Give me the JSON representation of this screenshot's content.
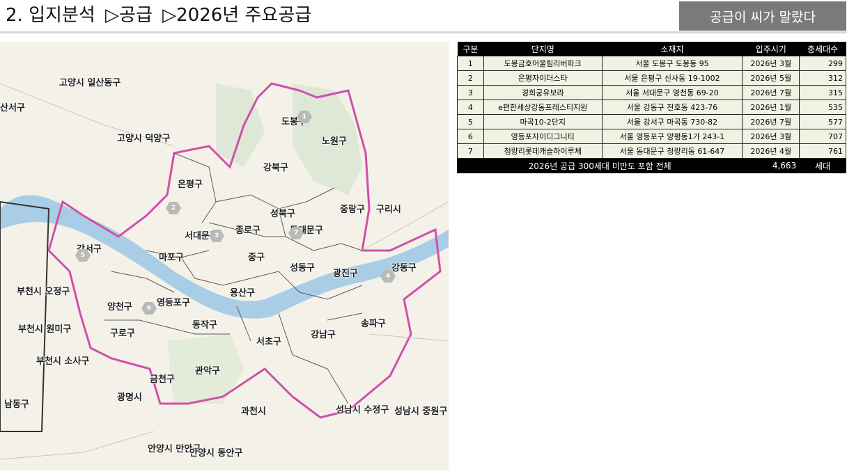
{
  "header": {
    "title_parts": [
      "2. 입지분석",
      "▷공급",
      "▷2026년 주요공급"
    ],
    "badge": "공급이 씨가 말랐다"
  },
  "map": {
    "labels": [
      {
        "text": "고양시 일산동구"
      },
      {
        "text": "산서구"
      },
      {
        "text": "고양시 덕양구"
      },
      {
        "text": "도봉구"
      },
      {
        "text": "노원구"
      },
      {
        "text": "강북구"
      },
      {
        "text": "은평구"
      },
      {
        "text": "성북구"
      },
      {
        "text": "중랑구"
      },
      {
        "text": "구리시"
      },
      {
        "text": "서대문구"
      },
      {
        "text": "종로구"
      },
      {
        "text": "동대문구"
      },
      {
        "text": "강서구"
      },
      {
        "text": "마포구"
      },
      {
        "text": "중구"
      },
      {
        "text": "성동구"
      },
      {
        "text": "광진구"
      },
      {
        "text": "강동구"
      },
      {
        "text": "부천시 오정구"
      },
      {
        "text": "용산구"
      },
      {
        "text": "양천구"
      },
      {
        "text": "영등포구"
      },
      {
        "text": "부천시 원미구"
      },
      {
        "text": "구로구"
      },
      {
        "text": "동작구"
      },
      {
        "text": "송파구"
      },
      {
        "text": "강남구"
      },
      {
        "text": "서초구"
      },
      {
        "text": "부천시 소사구"
      },
      {
        "text": "금천구"
      },
      {
        "text": "관악구"
      },
      {
        "text": "광명시"
      },
      {
        "text": "남동구"
      },
      {
        "text": "과천시"
      },
      {
        "text": "성남시 수정구"
      },
      {
        "text": "성남시 중원구"
      },
      {
        "text": "안양시 만안구"
      },
      {
        "text": "안양시 동안구"
      }
    ],
    "pins": [
      "1",
      "2",
      "3",
      "4",
      "5",
      "6",
      "7"
    ]
  },
  "table": {
    "headers": [
      "구분",
      "단지명",
      "소재지",
      "입주시기",
      "총세대수"
    ],
    "rows": [
      [
        "1",
        "도봉금호어울림리버파크",
        "서울 도봉구 도봉동 95",
        "2026년 3월",
        "299"
      ],
      [
        "2",
        "은평자이더스타",
        "서울 은평구 신사동 19-1002",
        "2026년 5월",
        "312"
      ],
      [
        "3",
        "경희궁유보라",
        "서울 서대문구 영천동 69-20",
        "2026년 7월",
        "315"
      ],
      [
        "4",
        "e편한세상강동프레스티지원",
        "서울 강동구 천호동 423-76",
        "2026년 1월",
        "535"
      ],
      [
        "5",
        "마곡10-2단지",
        "서울 강서구 마곡동 730-82",
        "2026년 7월",
        "577"
      ],
      [
        "6",
        "영등포자이디그니티",
        "서울 영등포구 양평동1가 243-1",
        "2026년 3월",
        "707"
      ],
      [
        "7",
        "청량리롯데캐슬하이루체",
        "서울 동대문구 청량리동 61-647",
        "2026년 4월",
        "761"
      ]
    ],
    "total": {
      "label": "2026년 공급 300세대 미만도 포함 전체",
      "value": "4,663",
      "unit": "세대"
    }
  }
}
